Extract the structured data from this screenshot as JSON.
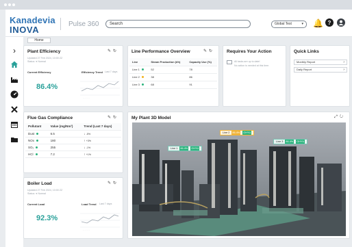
{
  "brand": {
    "line1": "Kanadevia",
    "line2": "INOVA",
    "app_name": "Pulse 360"
  },
  "header": {
    "search_placeholder": "Search",
    "site_select": "Global Test"
  },
  "breadcrumb": {
    "home": "Home"
  },
  "plant_efficiency": {
    "title": "Plant Efficiency",
    "updated": "Updated 27 Feb 2024, 10:00 ZZ",
    "status": "Status: ● Normal",
    "current_label": "Current Efficiency",
    "value": "86.4%",
    "trend_label": "Efficiency Trend",
    "trend_range": "Last 7 days"
  },
  "line_performance": {
    "title": "Line Performance Overview",
    "headers": [
      "Line",
      "Steam Production (t/h)",
      "Capacity Use (%)"
    ],
    "rows": [
      {
        "line": "Line 1",
        "steam": "52",
        "capacity": "78",
        "status": "green"
      },
      {
        "line": "Line 2",
        "steam": "38",
        "capacity": "86",
        "status": "yellow"
      },
      {
        "line": "Line 3",
        "steam": "68",
        "capacity": "91",
        "status": "green"
      }
    ]
  },
  "requires_action": {
    "title": "Requires Your Action",
    "line1": "All tasks are up to date!",
    "line2": "No action is needed at this time."
  },
  "quick_links": {
    "title": "Quick Links",
    "links": [
      "Monthly Report",
      "Daily Report"
    ]
  },
  "flue_gas": {
    "title": "Flue Gas Compliance",
    "headers": [
      "Pollutant",
      "Value (mg/Nm³)",
      "Trend (Last 7 days)"
    ],
    "rows": [
      {
        "pollutant": "Dust",
        "value": "6.5",
        "trend": "-5%"
      },
      {
        "pollutant": "NOx",
        "value": "180",
        "trend": "+3%"
      },
      {
        "pollutant": "SO₂",
        "value": "255",
        "trend": "-1%"
      },
      {
        "pollutant": "HCl",
        "value": "7.2",
        "trend": "+1%"
      }
    ]
  },
  "boiler_load": {
    "title": "Boiler Load",
    "updated": "Updated 27 Feb 2024, 10:00 ZZ",
    "status": "Status: ● Normal",
    "current_label": "Current Load",
    "value": "92.3%",
    "trend_label": "Load Trend",
    "trend_range": "Last 7 days"
  },
  "plant_model": {
    "title": "My Plant 3D Model",
    "tags": [
      {
        "label": "Line 1",
        "v1": "86.4%",
        "v2": "OHYU"
      },
      {
        "label": "Line 2",
        "v1": "86.4%",
        "v2": "OHYU"
      },
      {
        "label": "Line 3",
        "v1": "86.4%",
        "v2": "OHYU"
      }
    ]
  },
  "colors": {
    "accent": "#2aa19a",
    "brand": "#2f74b5",
    "ok": "#2ab37c",
    "warn": "#f2b21c"
  }
}
